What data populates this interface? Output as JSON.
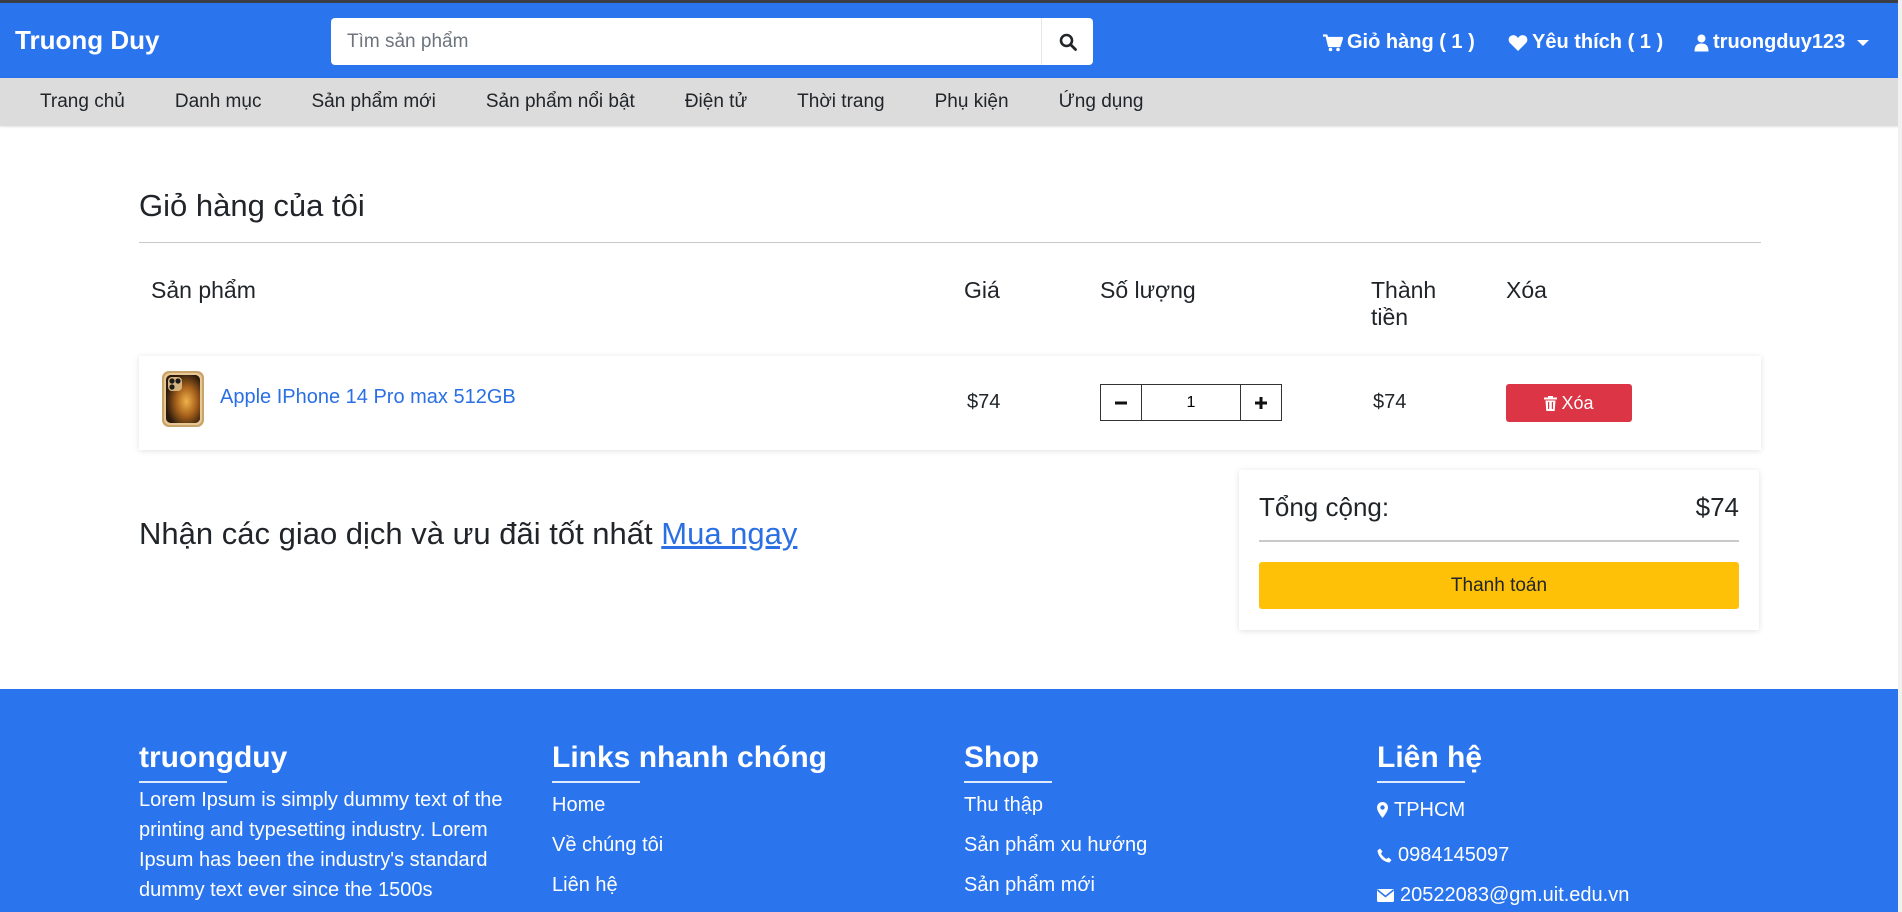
{
  "brand": "Truong Duy",
  "search": {
    "placeholder": "Tìm sản phẩm"
  },
  "header": {
    "cart_label": "Giỏ hàng ( 1 )",
    "wishlist_label": "Yêu thích ( 1 )",
    "user_label": "truongduy123"
  },
  "nav": {
    "items": [
      "Trang chủ",
      "Danh mục",
      "Sản phẩm mới",
      "Sản phẩm nổi bật",
      "Điện tử",
      "Thời trang",
      "Phụ kiện",
      "Ứng dụng"
    ]
  },
  "cart": {
    "title": "Giỏ hàng của tôi",
    "columns": {
      "product": "Sản phẩm",
      "price": "Giá",
      "quantity": "Số lượng",
      "total": "Thành tiền",
      "delete": "Xóa"
    },
    "items": [
      {
        "name": "Apple IPhone 14 Pro max 512GB",
        "price": "$74",
        "quantity": "1",
        "total": "$74",
        "delete_label": "Xóa"
      }
    ]
  },
  "promo": {
    "text": "Nhận các giao dịch và ưu đãi tốt nhất",
    "link": "Mua ngay"
  },
  "summary": {
    "label": "Tổng cộng:",
    "value": "$74",
    "checkout": "Thanh toán"
  },
  "footer": {
    "about": {
      "title": "truongduy",
      "text": "Lorem Ipsum is simply dummy text of the printing and typesetting industry. Lorem Ipsum has been the industry's standard dummy text ever since the 1500s"
    },
    "links": {
      "title": "Links nhanh chóng",
      "items": [
        "Home",
        "Về chúng tôi",
        "Liên hệ"
      ]
    },
    "shop": {
      "title": "Shop",
      "items": [
        "Thu thập",
        "Sản phẩm xu hướng",
        "Sản phẩm mới"
      ]
    },
    "contact": {
      "title": "Liên hệ",
      "address": "TPHCM",
      "phone": "0984145097",
      "email": "20522083@gm.uit.edu.vn"
    }
  },
  "colors": {
    "primary": "#2a74ee",
    "danger": "#dc3545",
    "warning": "#ffc107",
    "link": "#2a6fe4",
    "nav_bg": "#dcdcdc"
  }
}
